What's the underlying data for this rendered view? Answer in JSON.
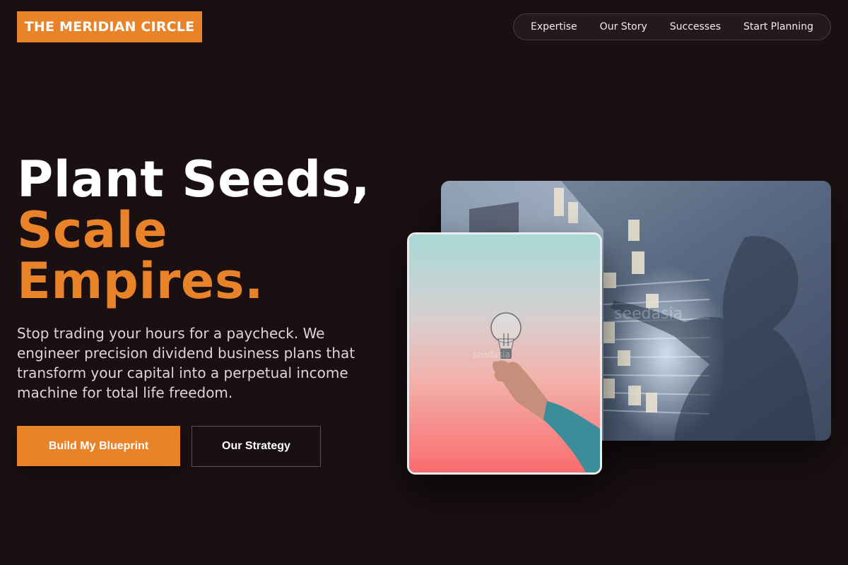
{
  "header": {
    "logo_text": "THE MERIDIAN CIRCLE",
    "nav": [
      {
        "label": "Expertise"
      },
      {
        "label": "Our Story"
      },
      {
        "label": "Successes"
      },
      {
        "label": "Start Planning"
      }
    ]
  },
  "hero": {
    "headline_line1": "Plant Seeds,",
    "headline_accent_line1": "Scale",
    "headline_accent_line2": "Empires.",
    "lead": "Stop trading your hours for a paycheck. We engineer precision dividend business plans that transform your capital into a perpetual income machine for total life freedom.",
    "primary_button": "Build My Blueprint",
    "secondary_button": "Our Strategy"
  },
  "images": {
    "back": {
      "subject": "person-at-sticky-note-wall-photo",
      "watermark": "seedasia"
    },
    "front": {
      "subject": "hand-holding-light-bulb-photo",
      "watermark": "seedasia"
    }
  },
  "colors": {
    "background": "#1a1011",
    "accent": "#e8832a",
    "text": "#ffffff"
  }
}
